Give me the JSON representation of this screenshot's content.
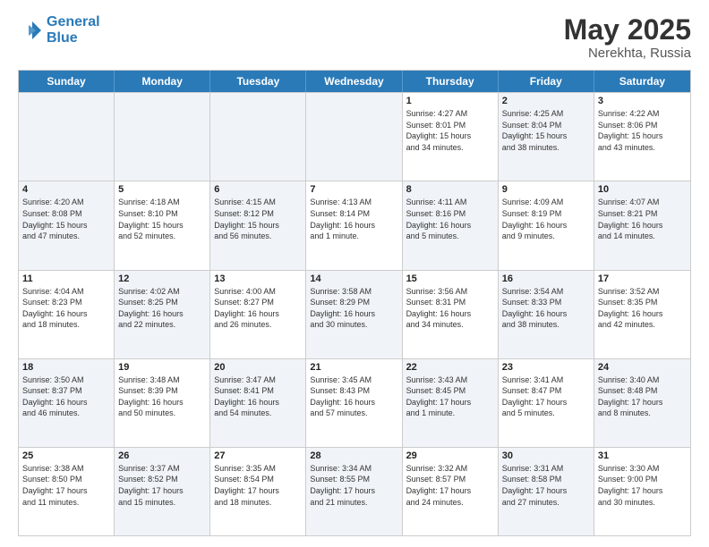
{
  "header": {
    "logo_line1": "General",
    "logo_line2": "Blue",
    "month_year": "May 2025",
    "location": "Nerekhta, Russia"
  },
  "weekdays": [
    "Sunday",
    "Monday",
    "Tuesday",
    "Wednesday",
    "Thursday",
    "Friday",
    "Saturday"
  ],
  "rows": [
    [
      {
        "day": "",
        "text": "",
        "shaded": true
      },
      {
        "day": "",
        "text": "",
        "shaded": true
      },
      {
        "day": "",
        "text": "",
        "shaded": true
      },
      {
        "day": "",
        "text": "",
        "shaded": true
      },
      {
        "day": "1",
        "text": "Sunrise: 4:27 AM\nSunset: 8:01 PM\nDaylight: 15 hours\nand 34 minutes."
      },
      {
        "day": "2",
        "text": "Sunrise: 4:25 AM\nSunset: 8:04 PM\nDaylight: 15 hours\nand 38 minutes.",
        "shaded": true
      },
      {
        "day": "3",
        "text": "Sunrise: 4:22 AM\nSunset: 8:06 PM\nDaylight: 15 hours\nand 43 minutes."
      }
    ],
    [
      {
        "day": "4",
        "text": "Sunrise: 4:20 AM\nSunset: 8:08 PM\nDaylight: 15 hours\nand 47 minutes.",
        "shaded": true
      },
      {
        "day": "5",
        "text": "Sunrise: 4:18 AM\nSunset: 8:10 PM\nDaylight: 15 hours\nand 52 minutes."
      },
      {
        "day": "6",
        "text": "Sunrise: 4:15 AM\nSunset: 8:12 PM\nDaylight: 15 hours\nand 56 minutes.",
        "shaded": true
      },
      {
        "day": "7",
        "text": "Sunrise: 4:13 AM\nSunset: 8:14 PM\nDaylight: 16 hours\nand 1 minute."
      },
      {
        "day": "8",
        "text": "Sunrise: 4:11 AM\nSunset: 8:16 PM\nDaylight: 16 hours\nand 5 minutes.",
        "shaded": true
      },
      {
        "day": "9",
        "text": "Sunrise: 4:09 AM\nSunset: 8:19 PM\nDaylight: 16 hours\nand 9 minutes."
      },
      {
        "day": "10",
        "text": "Sunrise: 4:07 AM\nSunset: 8:21 PM\nDaylight: 16 hours\nand 14 minutes.",
        "shaded": true
      }
    ],
    [
      {
        "day": "11",
        "text": "Sunrise: 4:04 AM\nSunset: 8:23 PM\nDaylight: 16 hours\nand 18 minutes."
      },
      {
        "day": "12",
        "text": "Sunrise: 4:02 AM\nSunset: 8:25 PM\nDaylight: 16 hours\nand 22 minutes.",
        "shaded": true
      },
      {
        "day": "13",
        "text": "Sunrise: 4:00 AM\nSunset: 8:27 PM\nDaylight: 16 hours\nand 26 minutes."
      },
      {
        "day": "14",
        "text": "Sunrise: 3:58 AM\nSunset: 8:29 PM\nDaylight: 16 hours\nand 30 minutes.",
        "shaded": true
      },
      {
        "day": "15",
        "text": "Sunrise: 3:56 AM\nSunset: 8:31 PM\nDaylight: 16 hours\nand 34 minutes."
      },
      {
        "day": "16",
        "text": "Sunrise: 3:54 AM\nSunset: 8:33 PM\nDaylight: 16 hours\nand 38 minutes.",
        "shaded": true
      },
      {
        "day": "17",
        "text": "Sunrise: 3:52 AM\nSunset: 8:35 PM\nDaylight: 16 hours\nand 42 minutes."
      }
    ],
    [
      {
        "day": "18",
        "text": "Sunrise: 3:50 AM\nSunset: 8:37 PM\nDaylight: 16 hours\nand 46 minutes.",
        "shaded": true
      },
      {
        "day": "19",
        "text": "Sunrise: 3:48 AM\nSunset: 8:39 PM\nDaylight: 16 hours\nand 50 minutes."
      },
      {
        "day": "20",
        "text": "Sunrise: 3:47 AM\nSunset: 8:41 PM\nDaylight: 16 hours\nand 54 minutes.",
        "shaded": true
      },
      {
        "day": "21",
        "text": "Sunrise: 3:45 AM\nSunset: 8:43 PM\nDaylight: 16 hours\nand 57 minutes."
      },
      {
        "day": "22",
        "text": "Sunrise: 3:43 AM\nSunset: 8:45 PM\nDaylight: 17 hours\nand 1 minute.",
        "shaded": true
      },
      {
        "day": "23",
        "text": "Sunrise: 3:41 AM\nSunset: 8:47 PM\nDaylight: 17 hours\nand 5 minutes."
      },
      {
        "day": "24",
        "text": "Sunrise: 3:40 AM\nSunset: 8:48 PM\nDaylight: 17 hours\nand 8 minutes.",
        "shaded": true
      }
    ],
    [
      {
        "day": "25",
        "text": "Sunrise: 3:38 AM\nSunset: 8:50 PM\nDaylight: 17 hours\nand 11 minutes."
      },
      {
        "day": "26",
        "text": "Sunrise: 3:37 AM\nSunset: 8:52 PM\nDaylight: 17 hours\nand 15 minutes.",
        "shaded": true
      },
      {
        "day": "27",
        "text": "Sunrise: 3:35 AM\nSunset: 8:54 PM\nDaylight: 17 hours\nand 18 minutes."
      },
      {
        "day": "28",
        "text": "Sunrise: 3:34 AM\nSunset: 8:55 PM\nDaylight: 17 hours\nand 21 minutes.",
        "shaded": true
      },
      {
        "day": "29",
        "text": "Sunrise: 3:32 AM\nSunset: 8:57 PM\nDaylight: 17 hours\nand 24 minutes."
      },
      {
        "day": "30",
        "text": "Sunrise: 3:31 AM\nSunset: 8:58 PM\nDaylight: 17 hours\nand 27 minutes.",
        "shaded": true
      },
      {
        "day": "31",
        "text": "Sunrise: 3:30 AM\nSunset: 9:00 PM\nDaylight: 17 hours\nand 30 minutes."
      }
    ]
  ]
}
